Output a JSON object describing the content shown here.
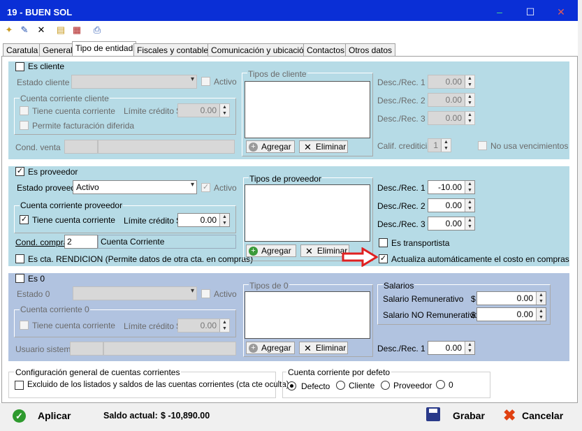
{
  "window": {
    "title": "19 - BUEN SOL",
    "minimize": "–",
    "maximize": "☐",
    "close": "✕"
  },
  "tabs": [
    "Caratula",
    "General",
    "Tipo de entidad",
    "Fiscales y contables",
    "Comunicación y ubicación",
    "Contactos",
    "Otros datos"
  ],
  "cliente": {
    "es_cliente_label": "Es cliente",
    "estado_label": "Estado cliente",
    "activo_label": "Activo",
    "cc_group": "Cuenta corriente cliente",
    "tiene_cc": "Tiene cuenta corriente",
    "limite_label": "Límite crédito $",
    "limite_value": "0.00",
    "permite_label": "Permite facturación diferida",
    "cond_venta_label": "Cond. venta",
    "tipos_label": "Tipos de cliente",
    "agregar": "Agregar",
    "eliminar": "Eliminar",
    "desc1_label": "Desc./Rec. 1",
    "desc1": "0.00",
    "desc2_label": "Desc./Rec. 2",
    "desc2": "0.00",
    "desc3_label": "Desc./Rec. 3",
    "desc3": "0.00",
    "calif_label": "Calif. crediticia",
    "calif": "1",
    "no_venc_label": "No usa vencimientos"
  },
  "proveedor": {
    "es_proveedor_label": "Es proveedor",
    "estado_label": "Estado proveed.",
    "estado_value": "Activo",
    "activo_label": "Activo",
    "cc_group": "Cuenta corriente proveedor",
    "tiene_cc": "Tiene cuenta corriente",
    "limite_label": "Límite crédito $",
    "limite_value": "0.00",
    "cond_compra_label": "Cond. compra",
    "cond_compra_value": "2",
    "cond_compra_text": "Cuenta Corriente",
    "rendicion_label": "Es cta. RENDICION (Permite datos de otra cta. en compras)",
    "tipos_label": "Tipos de proveedor",
    "agregar": "Agregar",
    "eliminar": "Eliminar",
    "desc1_label": "Desc./Rec. 1",
    "desc1": "-10.00",
    "desc2_label": "Desc./Rec. 2",
    "desc2": "0.00",
    "desc3_label": "Desc./Rec. 3",
    "desc3": "0.00",
    "transportista_label": "Es transportista",
    "actualiza_label": "Actualiza automáticamente el costo en compras"
  },
  "cero": {
    "es_label": "Es 0",
    "estado_label": "Estado 0",
    "activo_label": "Activo",
    "cc_group": "Cuenta corriente 0",
    "tiene_cc": "Tiene cuenta corriente",
    "limite_label": "Límite crédito $",
    "limite_value": "0.00",
    "usuario_label": "Usuario sistema",
    "tipos_label": "Tipos de 0",
    "agregar": "Agregar",
    "eliminar": "Eliminar",
    "salarios_label": "Salarios",
    "sal_rem_label": "Salario Remunerativo",
    "sal_rem_cur": "$",
    "sal_rem": "0.00",
    "sal_norem_label": "Salario NO Remunerativo",
    "sal_norem_cur": "$",
    "sal_norem": "0.00",
    "desc1_label": "Desc./Rec. 1",
    "desc1": "0.00"
  },
  "config": {
    "group_label": "Configuración general de cuentas corrientes",
    "excluido_label": "Excluido de los listados y saldos de las cuentas corrientes (cta cte oculta)",
    "cc_defecto_label": "Cuenta corriente por defeto",
    "opts": [
      "Defecto",
      "Cliente",
      "Proveedor",
      "0"
    ]
  },
  "footer": {
    "aplicar": "Aplicar",
    "saldo_label": "Saldo actual:",
    "saldo_value": "$ -10,890.00",
    "grabar": "Grabar",
    "cancelar": "Cancelar"
  },
  "colors": {
    "titlebar": "#0a2fd6",
    "band": "#b6dbe6",
    "band0": "#b1c3e0",
    "arrow": "#e02020"
  }
}
